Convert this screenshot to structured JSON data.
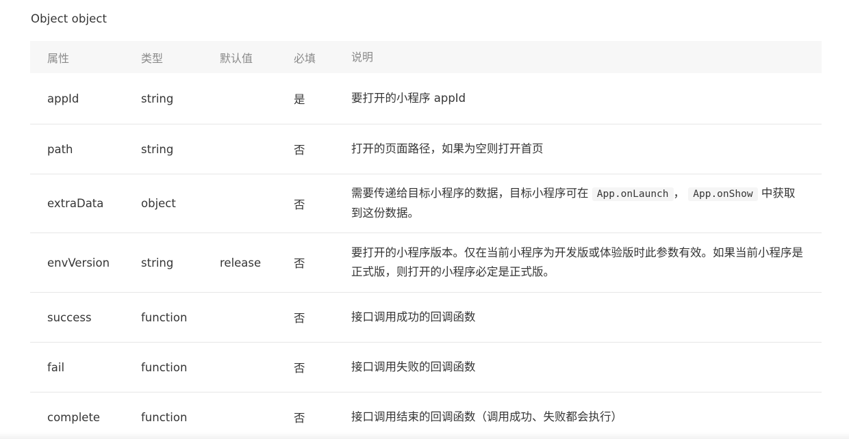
{
  "section": {
    "title": "Object object"
  },
  "table": {
    "headers": {
      "prop": "属性",
      "type": "类型",
      "default": "默认值",
      "required": "必填",
      "desc": "说明"
    },
    "rows": [
      {
        "prop": "appId",
        "type": "string",
        "default": "",
        "required": "是",
        "desc": "要打开的小程序 appId"
      },
      {
        "prop": "path",
        "type": "string",
        "default": "",
        "required": "否",
        "desc": "打开的页面路径，如果为空则打开首页"
      },
      {
        "prop": "extraData",
        "type": "object",
        "default": "",
        "required": "否",
        "desc_prefix": "需要传递给目标小程序的数据，目标小程序可在",
        "desc_code1": "App.onLaunch",
        "desc_sep": "，",
        "desc_code2": "App.onShow",
        "desc_suffix": "中获取到这份数据。"
      },
      {
        "prop": "envVersion",
        "type": "string",
        "default": "release",
        "required": "否",
        "desc": "要打开的小程序版本。仅在当前小程序为开发版或体验版时此参数有效。如果当前小程序是正式版，则打开的小程序必定是正式版。"
      },
      {
        "prop": "success",
        "type": "function",
        "default": "",
        "required": "否",
        "desc": "接口调用成功的回调函数"
      },
      {
        "prop": "fail",
        "type": "function",
        "default": "",
        "required": "否",
        "desc": "接口调用失败的回调函数"
      },
      {
        "prop": "complete",
        "type": "function",
        "default": "",
        "required": "否",
        "desc": "接口调用结束的回调函数（调用成功、失败都会执行）"
      }
    ]
  }
}
